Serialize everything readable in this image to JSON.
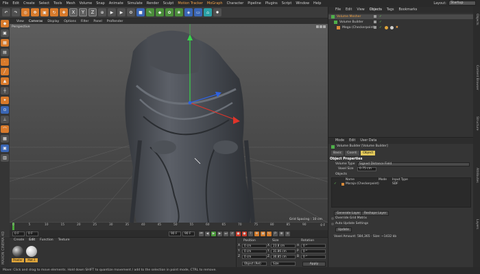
{
  "menu": {
    "items": [
      "File",
      "Edit",
      "Create",
      "Select",
      "Tools",
      "Mesh",
      "Volume",
      "Snap",
      "Animate",
      "Simulate",
      "Render",
      "Sculpt",
      "Motion Tracker",
      "MoGraph",
      "Character",
      "Pipeline",
      "Plugins",
      "Script",
      "Window",
      "Help"
    ],
    "highlighted": [
      "Motion Tracker",
      "MoGraph"
    ],
    "layout_label": "Layout:",
    "layout_value": "Startup"
  },
  "toolbar": {
    "axis_x": "X",
    "axis_y": "Y",
    "axis_z": "Z"
  },
  "viewport": {
    "menu": [
      "View",
      "Cameras",
      "Display",
      "Options",
      "Filter",
      "Panel",
      "ProRender"
    ],
    "active_menu": "Cameras",
    "label": "Perspective",
    "grid_spacing": "Grid Spacing : 10 cm"
  },
  "timeline": {
    "ticks": [
      "0",
      "5",
      "10",
      "15",
      "20",
      "25",
      "30",
      "35",
      "40",
      "45",
      "50",
      "55",
      "60",
      "65",
      "70",
      "75",
      "80",
      "85",
      "90"
    ],
    "frame_end_marker": "0 F",
    "start_field": "0 F",
    "current_field": "0 F",
    "end_field": "90 F",
    "end_field2": "90 F"
  },
  "material_manager": {
    "menu": [
      "Create",
      "Edit",
      "Function",
      "Texture"
    ],
    "materials": [
      "Pewter",
      "Mat.1"
    ],
    "logo": "MAXON CINEMA 4D"
  },
  "coordinates": {
    "headers": [
      "Position",
      "Size",
      "Rotation"
    ],
    "rows": [
      {
        "axis": "X",
        "pos": "0 cm",
        "size": "23.8 cm",
        "rot_axis": "H",
        "rot": "0 °"
      },
      {
        "axis": "Y",
        "pos": "0 cm",
        "size": "31.86 cm",
        "rot_axis": "P",
        "rot": "0 °"
      },
      {
        "axis": "Z",
        "pos": "0 cm",
        "size": "30.85 cm",
        "rot_axis": "B",
        "rot": "0 °"
      }
    ],
    "object_mode": "Object (Rel)",
    "size_mode": "Size",
    "apply": "Apply"
  },
  "object_manager": {
    "menu": [
      "File",
      "Edit",
      "View",
      "Objects",
      "Tags",
      "Bookmarks"
    ],
    "active_menu": "Objects",
    "rows": [
      "Volume Mesher",
      "Volume Builder",
      "Mega (Checkerpoint)"
    ]
  },
  "attribute_manager": {
    "menu": [
      "Mode",
      "Edit",
      "User Data"
    ],
    "title": "Volume Builder [Volume Builder]",
    "tabs": [
      "Basic",
      "Coord.",
      "Object"
    ],
    "active_tab": "Object",
    "section_object": "Object Properties",
    "volume_type_label": "Volume Type",
    "volume_type_value": "Signed Distance Field",
    "voxel_size_label": "Voxel Size",
    "voxel_size_value": "0.75 cm",
    "objects_label": "Objects",
    "col_name": "Name",
    "col_mode": "Mode",
    "col_input": "Input Type",
    "obj_row_name": "Maraja (Checkerpoint)",
    "obj_row_input": "SDF",
    "layer_buttons": [
      "Generate Layer",
      "Reshape Layer"
    ],
    "override_label": "Override Grid Matrix",
    "auto_update_label": "Auto Update Settings",
    "update_btn": "Update",
    "voxel_amount": "Voxel Amount: 584,365 · Size: ~1432 kb"
  },
  "right_strip": [
    "Objects",
    "Content Browser",
    "Structure",
    "Attributes",
    "Layers"
  ],
  "status": "Move: Click and drag to move elements. Hold down SHIFT to quantize movement / add to the selection in point mode, CTRL to remove."
}
